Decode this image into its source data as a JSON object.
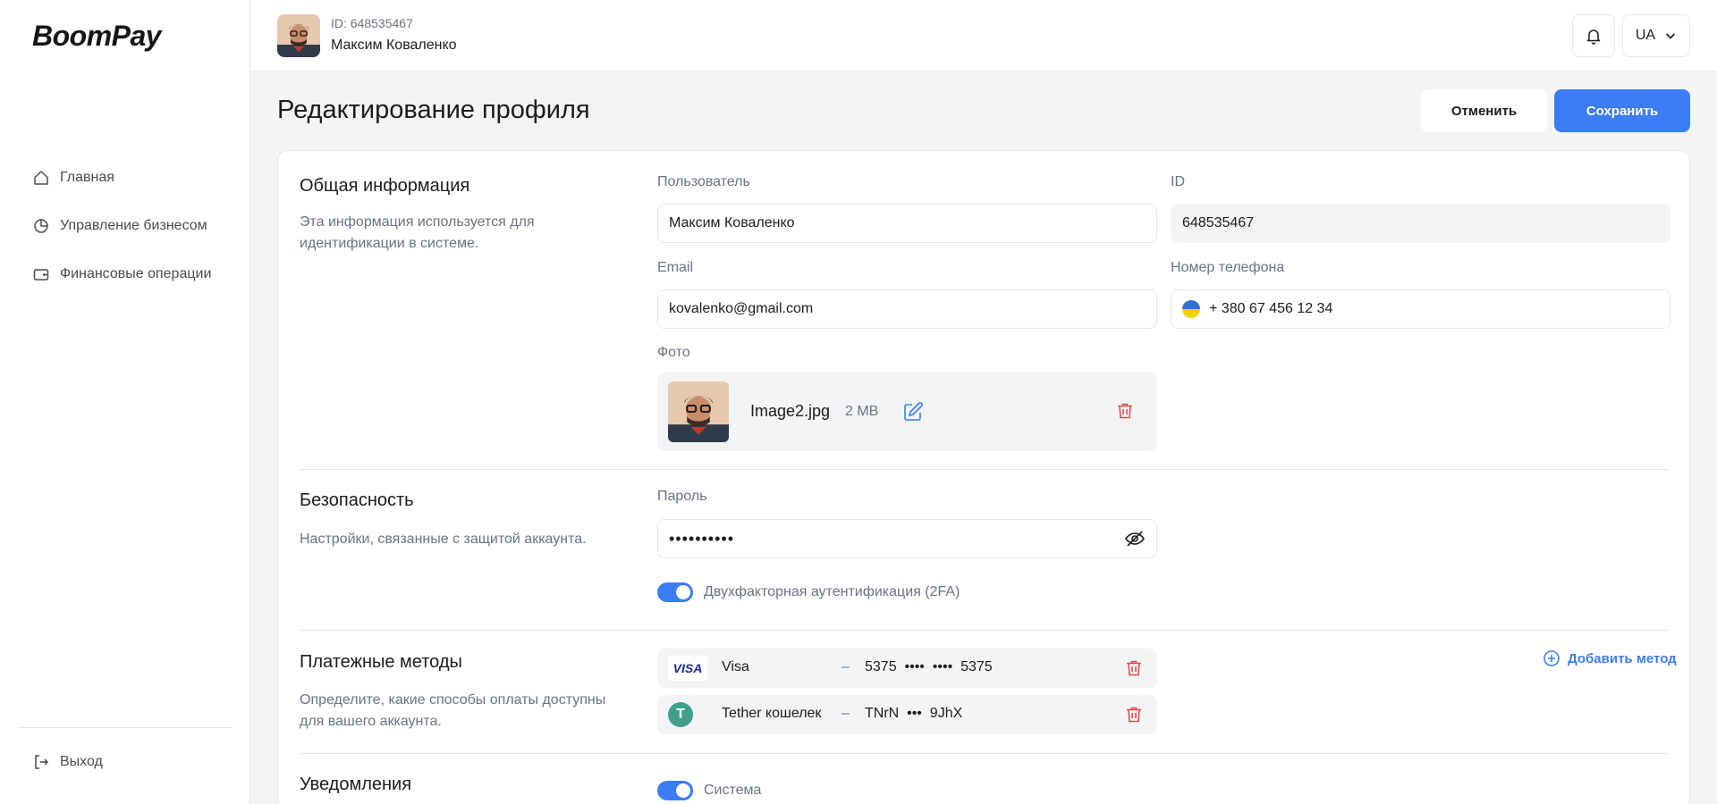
{
  "app": {
    "logo": "BoomPay"
  },
  "sidebar": {
    "items": [
      {
        "label": "Главная",
        "icon": "home-icon"
      },
      {
        "label": "Управление бизнесом",
        "icon": "pie-chart-icon"
      },
      {
        "label": "Финансовые операции",
        "icon": "wallet-icon"
      }
    ],
    "logout_label": "Выход"
  },
  "topbar": {
    "user_id": "ID: 648535467",
    "user_name": "Максим Коваленко",
    "lang": "UA"
  },
  "page": {
    "title": "Редактирование профиля",
    "cancel_label": "Отменить",
    "save_label": "Сохранить"
  },
  "general": {
    "title": "Общая информация",
    "desc": "Эта информация используется для идентификации в системе.",
    "user_label": "Пользователь",
    "user_value": "Максим Коваленко",
    "id_label": "ID",
    "id_value": "648535467",
    "email_label": "Email",
    "email_value": "kovalenko@gmail.com",
    "phone_label": "Номер телефона",
    "phone_value": "+ 380 67 456 12 34",
    "photo_label": "Фото",
    "photo_name": "Image2.jpg",
    "photo_size": "2 MB"
  },
  "security": {
    "title": "Безопасность",
    "desc": "Настройки, связанные с защитой аккаунта.",
    "password_label": "Пароль",
    "password_value": "••••••••••",
    "twofa_label": "Двухфакторная аутентификация (2FA)",
    "twofa_enabled": true
  },
  "payments": {
    "title": "Платежные методы",
    "desc": "Определите, какие способы оплаты доступны для вашего аккаунта.",
    "add_label": "Добавить метод",
    "methods": [
      {
        "name": "Visa",
        "dash": "–",
        "number": "5375  ••••  ••••  5375",
        "logo": "VISA"
      },
      {
        "name": "Tether кошелек",
        "dash": "–",
        "number": "TNrN  •••  9JhX",
        "logo": "T"
      }
    ]
  },
  "notifications": {
    "title": "Уведомления",
    "system_label": "Система",
    "system_enabled": true
  },
  "colors": {
    "accent": "#3b7df5",
    "danger": "#e5484d",
    "tether": "#3ea089"
  }
}
